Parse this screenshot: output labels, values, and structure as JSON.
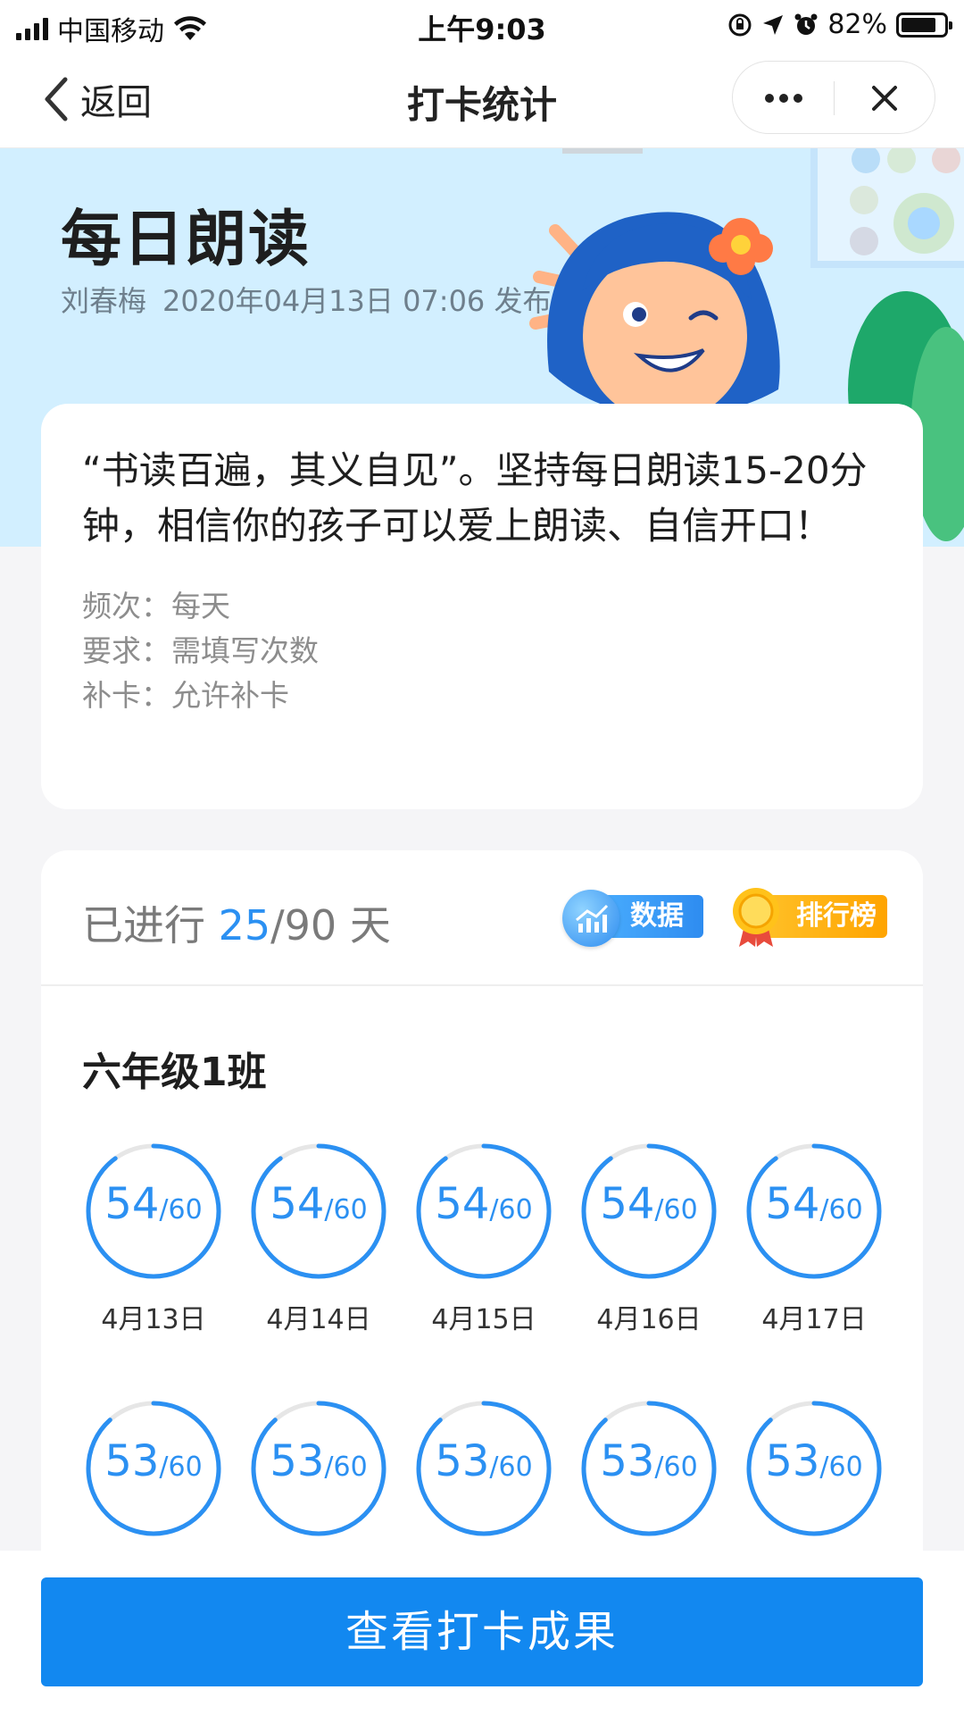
{
  "status_bar": {
    "carrier": "中国移动",
    "time": "上午9:03",
    "battery": "82%",
    "battery_level": 0.82,
    "icons": [
      "signal-icon",
      "wifi-icon",
      "orientation-lock-icon",
      "location-icon",
      "alarm-icon",
      "battery-icon"
    ]
  },
  "nav": {
    "back_label": "返回",
    "title": "打卡统计",
    "icons": [
      "chevron-left-icon",
      "more-icon",
      "close-icon"
    ]
  },
  "banner": {
    "title": "每日朗读",
    "author": "刘春梅",
    "published": "2020年04月13日 07:06 发布",
    "background": "#d2efff"
  },
  "description": {
    "text": "“书读百遍，其义自见”。坚持每日朗读15-20分钟，相信你的孩子可以爱上朗读、自信开口！",
    "rules": [
      {
        "key": "频次：",
        "value": "每天"
      },
      {
        "key": "要求：",
        "value": "需填写次数"
      },
      {
        "key": "补卡：",
        "value": "允许补卡"
      }
    ]
  },
  "stats": {
    "prefix": "已进行 ",
    "current": "25",
    "total": "/90 天",
    "data_button": "数据",
    "rank_button": "排行榜",
    "class_name": "六年级1班",
    "accent": "#2b90f2",
    "days": [
      {
        "value": "54",
        "total": "/60",
        "date": "4月13日"
      },
      {
        "value": "54",
        "total": "/60",
        "date": "4月14日"
      },
      {
        "value": "54",
        "total": "/60",
        "date": "4月15日"
      },
      {
        "value": "54",
        "total": "/60",
        "date": "4月16日"
      },
      {
        "value": "54",
        "total": "/60",
        "date": "4月17日"
      },
      {
        "value": "53",
        "total": "/60",
        "date": ""
      },
      {
        "value": "53",
        "total": "/60",
        "date": ""
      },
      {
        "value": "53",
        "total": "/60",
        "date": ""
      },
      {
        "value": "53",
        "total": "/60",
        "date": ""
      },
      {
        "value": "53",
        "total": "/60",
        "date": ""
      }
    ]
  },
  "footer": {
    "cta_label": "查看打卡成果",
    "cta_color": "#1288f0"
  }
}
